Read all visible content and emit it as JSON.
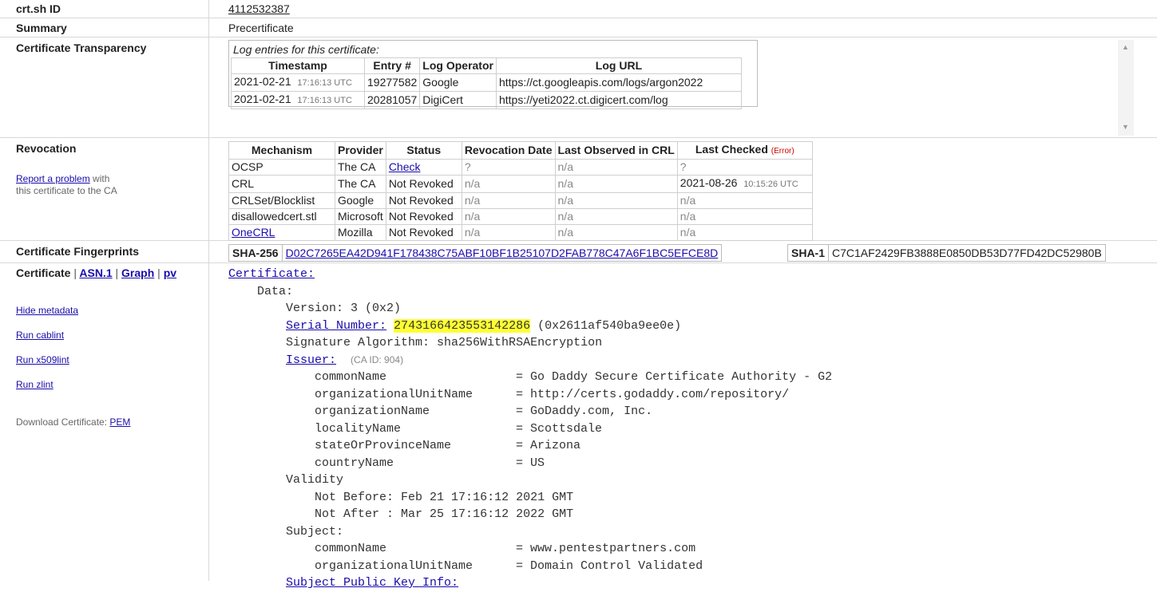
{
  "rows": {
    "id": {
      "label": "crt.sh ID",
      "value": "4112532387"
    },
    "summary": {
      "label": "Summary",
      "value": "Precertificate"
    },
    "ct": {
      "label": "Certificate Transparency",
      "caption": "Log entries for this certificate:",
      "headers": [
        "Timestamp",
        "Entry #",
        "Log Operator",
        "Log URL"
      ],
      "entries": [
        {
          "date": "2021-02-21",
          "time": "17:16:13 UTC",
          "entry": "19277582",
          "operator": "Google",
          "url": "https://ct.googleapis.com/logs/argon2022"
        },
        {
          "date": "2021-02-21",
          "time": "17:16:13 UTC",
          "entry": "20281057",
          "operator": "DigiCert",
          "url": "https://yeti2022.ct.digicert.com/log"
        }
      ]
    },
    "revocation": {
      "label": "Revocation",
      "report_link": "Report a problem",
      "report_text1": " with",
      "report_text2": "this certificate to the CA",
      "headers": [
        "Mechanism",
        "Provider",
        "Status",
        "Revocation Date",
        "Last Observed in CRL",
        "Last Checked"
      ],
      "error_label": "(Error)",
      "rows": [
        {
          "mechanism": "OCSP",
          "provider": "The CA",
          "status": "Check",
          "rev_date": "?",
          "last_obs": "n/a",
          "checked_date": "?",
          "checked_time": ""
        },
        {
          "mechanism": "CRL",
          "provider": "The CA",
          "status": "Not Revoked",
          "rev_date": "n/a",
          "last_obs": "n/a",
          "checked_date": "2021-08-26",
          "checked_time": "10:15:26 UTC"
        },
        {
          "mechanism": "CRLSet/Blocklist",
          "provider": "Google",
          "status": "Not Revoked",
          "rev_date": "n/a",
          "last_obs": "n/a",
          "checked_date": "n/a",
          "checked_time": ""
        },
        {
          "mechanism": "disallowedcert.stl",
          "provider": "Microsoft",
          "status": "Not Revoked",
          "rev_date": "n/a",
          "last_obs": "n/a",
          "checked_date": "n/a",
          "checked_time": ""
        },
        {
          "mechanism": "OneCRL",
          "provider": "Mozilla",
          "status": "Not Revoked",
          "rev_date": "n/a",
          "last_obs": "n/a",
          "checked_date": "n/a",
          "checked_time": ""
        }
      ]
    },
    "fingerprints": {
      "label": "Certificate Fingerprints",
      "sha256_label": "SHA-256",
      "sha256": "D02C7265EA42D941F178438C75ABF10BF1B25107D2FAB778C47A6F1BC5EFCE8D",
      "sha1_label": "SHA-1",
      "sha1": "C7C1AF2429FB3888E0850DB53D77FD42DC52980B"
    },
    "certificate": {
      "label": "Certificate",
      "sep": "|",
      "asn1": "ASN.1",
      "graph": "Graph",
      "pv": "pv",
      "hide_metadata": "Hide metadata",
      "run_cablint": "Run cablint",
      "run_x509lint": "Run x509lint",
      "run_zlint": "Run zlint",
      "download_label": "Download Certificate: ",
      "download_pem": "PEM"
    }
  },
  "cert_text": {
    "certificate_link": "Certificate:",
    "data": "Data:",
    "version": "Version: 3 (0x2)",
    "serial_link": "Serial Number:",
    "serial_dec": "2743166423553142286",
    "serial_hex": " (0x2611af540ba9ee0e)",
    "sig_alg": "Signature Algorithm: sha256WithRSAEncryption",
    "issuer_link": "Issuer:",
    "issuer_ca": "(CA ID: 904)",
    "issuer_fields": [
      {
        "k": "commonName",
        "v": "Go Daddy Secure Certificate Authority - G2"
      },
      {
        "k": "organizationalUnitName",
        "v": "http://certs.godaddy.com/repository/"
      },
      {
        "k": "organizationName",
        "v": "GoDaddy.com, Inc."
      },
      {
        "k": "localityName",
        "v": "Scottsdale"
      },
      {
        "k": "stateOrProvinceName",
        "v": "Arizona"
      },
      {
        "k": "countryName",
        "v": "US"
      }
    ],
    "validity": "Validity",
    "not_before": "Not Before: Feb 21 17:16:12 2021 GMT",
    "not_after": "Not After : Mar 25 17:16:12 2022 GMT",
    "subject": "Subject:",
    "subject_fields": [
      {
        "k": "commonName",
        "v": "www.pentestpartners.com"
      },
      {
        "k": "organizationalUnitName",
        "v": "Domain Control Validated"
      }
    ],
    "spki_link": "Subject Public Key Info:"
  },
  "colors": {
    "link": "#1a0dab",
    "highlight": "#ffff33",
    "error": "#cc0000"
  }
}
